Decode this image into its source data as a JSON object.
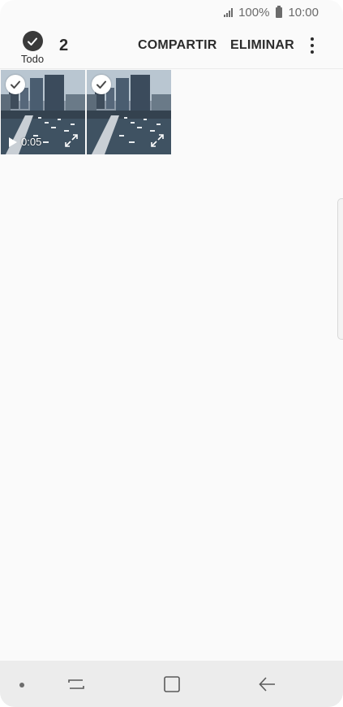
{
  "status_bar": {
    "battery_percent": "100%",
    "time": "10:00",
    "icons": [
      "signal-icon",
      "battery-icon"
    ]
  },
  "action_bar": {
    "select_all_label": "Todo",
    "selected_count": "2",
    "share_label": "COMPARTIR",
    "delete_label": "ELIMINAR",
    "icons": [
      "check-circle-icon",
      "more-options-icon"
    ]
  },
  "thumbnails": [
    {
      "type": "video",
      "selected": true,
      "duration": "0:05",
      "icons": [
        "check-icon",
        "play-icon",
        "expand-icon"
      ]
    },
    {
      "type": "image",
      "selected": true,
      "icons": [
        "check-icon",
        "expand-icon"
      ]
    }
  ],
  "nav_bar": {
    "icons": [
      "nav-dot-icon",
      "recent-apps-icon",
      "home-icon",
      "back-icon"
    ]
  },
  "colors": {
    "background": "#fafafa",
    "text_dark": "#2c2c2c",
    "nav_bar": "#ececec",
    "status_text": "#6b6b6b"
  }
}
